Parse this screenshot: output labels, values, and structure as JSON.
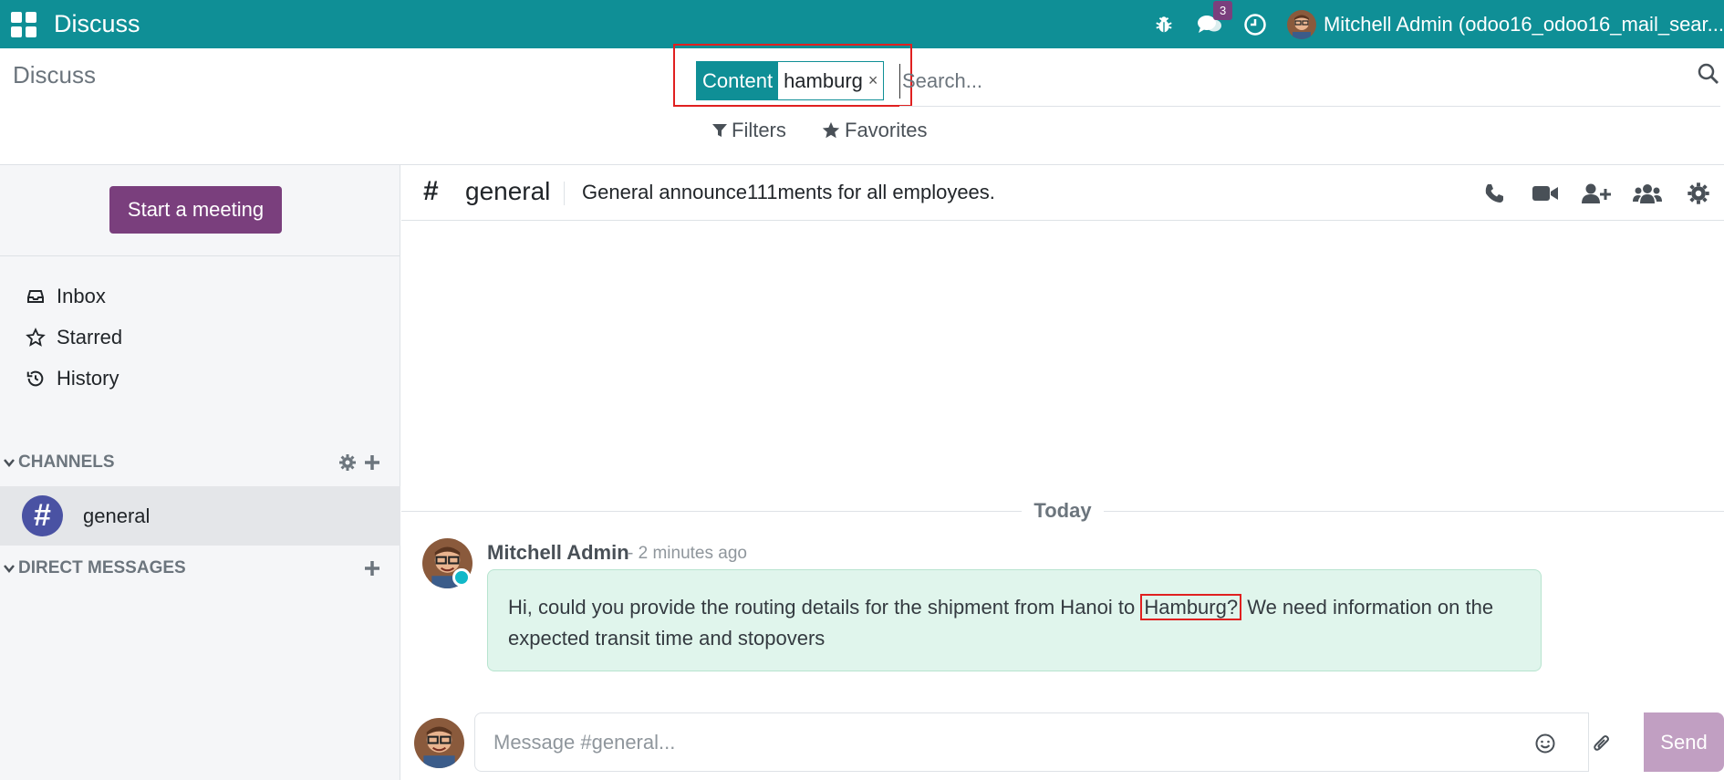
{
  "navbar": {
    "app_name": "Discuss",
    "chat_badge_count": "3",
    "user_name": "Mitchell Admin (odoo16_odoo16_mail_sear..."
  },
  "control_panel": {
    "title": "Discuss",
    "facet_label": "Content",
    "facet_value": "hamburg",
    "facet_remove": "×",
    "search_placeholder": "Search...",
    "filters_label": "Filters",
    "favorites_label": "Favorites"
  },
  "sidebar": {
    "start_meeting_label": "Start a meeting",
    "mailboxes": [
      {
        "label": "Inbox",
        "icon": "inbox-icon"
      },
      {
        "label": "Starred",
        "icon": "star-icon"
      },
      {
        "label": "History",
        "icon": "history-icon"
      }
    ],
    "channels_header": "CHANNELS",
    "channels": [
      {
        "name": "general",
        "avatar_glyph": "#"
      }
    ],
    "direct_messages_header": "DIRECT MESSAGES"
  },
  "thread": {
    "hash": "#",
    "name": "general",
    "description": "General announce111ments for all employees.",
    "date_separator": "Today",
    "messages": [
      {
        "author": "Mitchell Admin",
        "date": "- 2 minutes ago",
        "body_before": "Hi, could you provide the routing details for the shipment from Hanoi to ",
        "body_highlight": "Hamburg?",
        "body_after": " We need information on the expected transit time and stopovers"
      }
    ]
  },
  "composer": {
    "placeholder": "Message #general...",
    "send_label": "Send"
  },
  "colors": {
    "brand": "#0f8f96",
    "primary_button": "#7a3f7d",
    "message_bubble": "#e0f5ec",
    "highlight_box": "#e02020"
  }
}
